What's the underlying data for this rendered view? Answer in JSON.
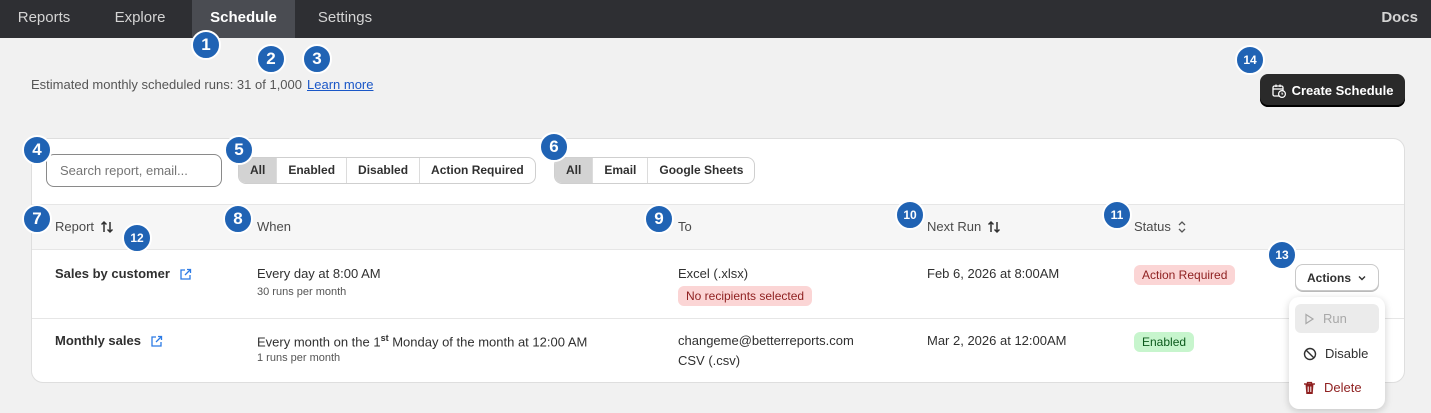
{
  "nav": {
    "items": [
      {
        "label": "Reports"
      },
      {
        "label": "Explore"
      },
      {
        "label": "Schedule"
      },
      {
        "label": "Settings"
      }
    ],
    "docs": "Docs"
  },
  "usage": {
    "text": "Estimated monthly scheduled runs: 31 of 1,000",
    "link": "Learn more"
  },
  "create_button": "Create Schedule",
  "search": {
    "placeholder": "Search report, email..."
  },
  "status_filter": [
    "All",
    "Enabled",
    "Disabled",
    "Action Required"
  ],
  "status_filter_selected": "All",
  "destination_filter": [
    "All",
    "Email",
    "Google Sheets"
  ],
  "destination_filter_selected": "All",
  "columns": {
    "report": "Report",
    "when": "When",
    "to": "To",
    "next_run": "Next Run",
    "status": "Status"
  },
  "rows": [
    {
      "report": "Sales by customer",
      "when": "Every day at 8:00 AM",
      "when_sub": "30 runs per month",
      "to_line1": "Excel (.xlsx)",
      "to_badge": "No recipients selected",
      "next_run": "Feb 6, 2026 at 8:00AM",
      "status": "Action Required",
      "status_color": "#fbd5d5"
    },
    {
      "report": "Monthly sales",
      "when_pre": "Every month on the 1",
      "when_sup": "st",
      "when_post": " Monday of the month at 12:00 AM",
      "when_sub": "1 runs per month",
      "to_line1": "changeme@betterreports.com",
      "to_line2": "CSV (.csv)",
      "next_run": "Mar 2, 2026 at 12:00AM",
      "status": "Enabled",
      "status_color": "#c7f5cd"
    }
  ],
  "actions": {
    "button": "Actions",
    "menu": {
      "run": "Run",
      "disable": "Disable",
      "delete": "Delete"
    }
  },
  "markers": [
    "1",
    "2",
    "3",
    "4",
    "5",
    "6",
    "7",
    "8",
    "9",
    "10",
    "11",
    "12",
    "13",
    "14"
  ],
  "colors": {
    "marker": "#2063b4",
    "nav_bg": "#2e2f33",
    "danger": "#8e1f1f",
    "link": "#1a57c7"
  }
}
